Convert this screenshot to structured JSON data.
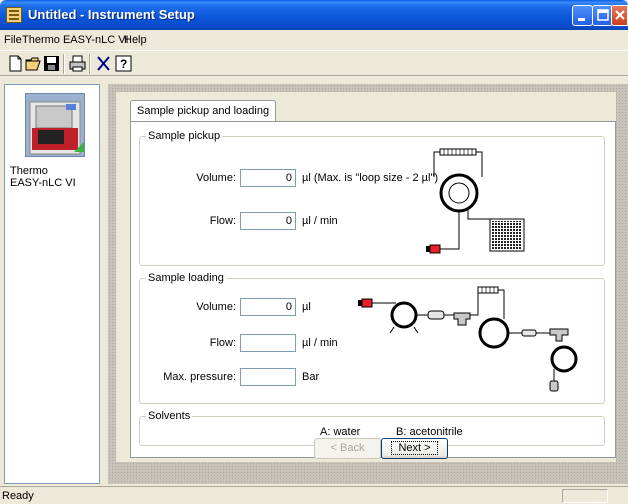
{
  "window": {
    "title": "Untitled - Instrument Setup"
  },
  "menu": {
    "items": [
      {
        "label": "File"
      },
      {
        "label": "Thermo EASY-nLC VI"
      },
      {
        "label": "Help"
      }
    ]
  },
  "toolbar": {
    "icons": [
      "new-document-icon",
      "open-folder-icon",
      "save-icon",
      "print-icon",
      "cut-icon",
      "help-icon"
    ]
  },
  "left_panel": {
    "device_name": "Thermo EASY-nLC VI",
    "device_name_line1": "Thermo",
    "device_name_line2": "EASY-nLC VI"
  },
  "tab": {
    "label": "Sample pickup and loading"
  },
  "sample_pickup": {
    "title": "Sample pickup",
    "volume_label": "Volume:",
    "volume_value": "0",
    "volume_unit": "µl (Max. is \"loop size - 2 µl\")",
    "flow_label": "Flow:",
    "flow_value": "0",
    "flow_unit": "µl / min"
  },
  "sample_loading": {
    "title": "Sample loading",
    "volume_label": "Volume:",
    "volume_value": "0",
    "volume_unit": "µl",
    "flow_label": "Flow:",
    "flow_value": "",
    "flow_unit": "µl / min",
    "pressure_label": "Max. pressure:",
    "pressure_value": "",
    "pressure_unit": "Bar"
  },
  "solvents": {
    "title": "Solvents",
    "a": "A: water",
    "b": "B: acetonitrile"
  },
  "buttons": {
    "back": "< Back",
    "next": "Next >"
  },
  "status": {
    "text": "Ready"
  },
  "colors": {
    "titlebar": "#0A5FE8",
    "accent_red": "#E8202A",
    "window_bg": "#ECE9D8"
  }
}
